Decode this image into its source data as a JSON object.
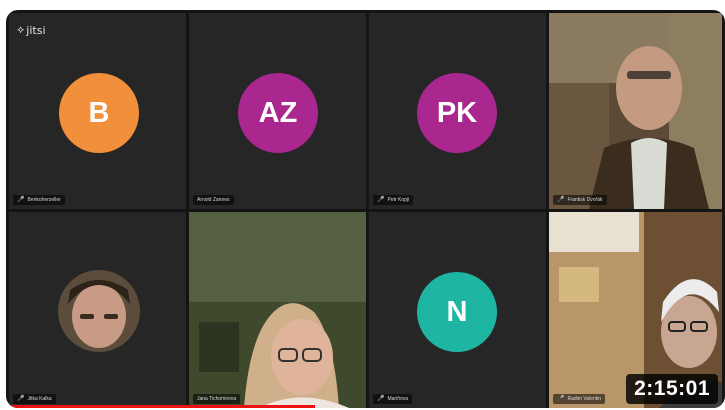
{
  "app": {
    "logo_text": "jitsi"
  },
  "participants": [
    {
      "initials": "B",
      "name": "Benkoherzeller",
      "color": "#f28f3b"
    },
    {
      "initials": "AZ",
      "name": "Arnold Zannes",
      "color": "#a9278e"
    },
    {
      "initials": "PK",
      "name": "Petr Kopji",
      "color": "#a9278e"
    },
    {
      "name": "Frantisk Dvořák",
      "video": true
    },
    {
      "name": "Jitka Kalka",
      "video": true
    },
    {
      "name": "Jana Tichomirova",
      "video": true
    },
    {
      "initials": "N",
      "name": "Mariňova",
      "color": "#1fb5a3"
    },
    {
      "name": "Radim Valentin",
      "video": true
    }
  ],
  "player": {
    "elapsed": "2:15:01",
    "progress_fraction": 0.43
  }
}
